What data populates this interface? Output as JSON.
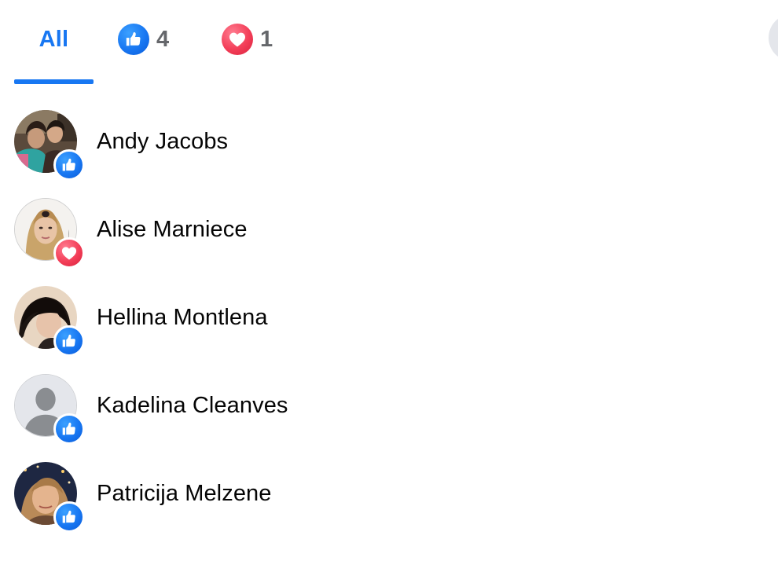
{
  "tabs": {
    "all_label": "All",
    "like_count": "4",
    "love_count": "1"
  },
  "people": [
    {
      "name": "Andy Jacobs",
      "reaction": "like"
    },
    {
      "name": "Alise Marniece",
      "reaction": "love"
    },
    {
      "name": "Hellina Montlena",
      "reaction": "like"
    },
    {
      "name": "Kadelina Cleanves",
      "reaction": "like"
    },
    {
      "name": "Patricija Melzene",
      "reaction": "like"
    }
  ],
  "colors": {
    "accent": "#1877f2",
    "like": "#1877f2",
    "love": "#f33e58",
    "muted_text": "#65676b",
    "name_text": "#050505"
  },
  "icons": {
    "like": "thumbs-up-icon",
    "love": "heart-icon",
    "default_avatar": "person-silhouette-icon"
  }
}
